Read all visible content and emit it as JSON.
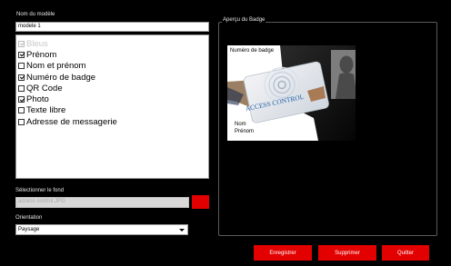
{
  "form": {
    "name_label": "Nom du modèle",
    "name_value": "modele 1",
    "fields": [
      {
        "label": "Bleus",
        "checked": true,
        "enabled": false
      },
      {
        "label": "Prénom",
        "checked": true,
        "enabled": true
      },
      {
        "label": "Nom et prénom",
        "checked": false,
        "enabled": true
      },
      {
        "label": "Numéro de badge",
        "checked": true,
        "enabled": true
      },
      {
        "label": "QR Code",
        "checked": false,
        "enabled": true
      },
      {
        "label": "Photo",
        "checked": true,
        "enabled": true
      },
      {
        "label": "Texte libre",
        "checked": false,
        "enabled": true
      },
      {
        "label": "Adresse de messagerie",
        "checked": false,
        "enabled": true
      }
    ],
    "background_label": "Sélectionner le fond",
    "background_value": "access control.JPG",
    "background_button_color": "#e30000",
    "orientation_label": "Orientation",
    "orientation_value": "Paysage"
  },
  "preview": {
    "label": "Aperçu du Badge",
    "badge_number_label": "Numéro de badge",
    "card_text": "ACCESS CONTROL",
    "nom_label": "Nom",
    "prenom_label": "Prénom"
  },
  "buttons": {
    "save": "Enregistrer",
    "delete": "Supprimer",
    "quit": "Quitter"
  },
  "colors": {
    "background": "#000000",
    "accent": "#e30000"
  }
}
